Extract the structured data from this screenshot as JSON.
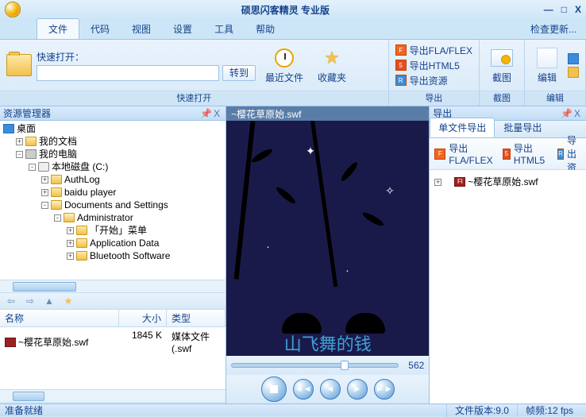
{
  "title": "硕思闪客精灵 专业版",
  "window": {
    "min": "—",
    "max": "□",
    "close": "X"
  },
  "menu": {
    "tabs": [
      "文件",
      "代码",
      "视图",
      "设置",
      "工具",
      "帮助"
    ],
    "active": 0,
    "update": "检查更新..."
  },
  "ribbon": {
    "quickopen": {
      "label": "快速打开：",
      "goto": "转到",
      "group": "快速打开",
      "value": ""
    },
    "recent": "最近文件",
    "fav": "收藏夹",
    "export_rows": [
      "导出FLA/FLEX",
      "导出HTML5",
      "导出资源"
    ],
    "export_group": "导出",
    "screenshot": "截图",
    "screenshot_group": "截图",
    "edit": "编辑",
    "edit_group": "编辑"
  },
  "left": {
    "title": "资源管理器",
    "pin": "📌",
    "close": "X",
    "tree": {
      "desktop": "桌面",
      "mydocs": "我的文档",
      "mypc": "我的电脑",
      "drive": "本地磁盘 (C:)",
      "folders": [
        "AuthLog",
        "baidu player",
        "Documents and Settings"
      ],
      "admin": "Administrator",
      "admin_children": [
        "「开始」菜单",
        "Application Data",
        "Bluetooth Software"
      ]
    },
    "nav": {
      "back": "⇦",
      "fwd": "⇨",
      "up": "▲",
      "star": "★"
    },
    "columns": {
      "name": "名称",
      "size": "大小",
      "type": "类型"
    },
    "file": {
      "name": "~樱花草原始.swf",
      "size": "1845 K",
      "type": "媒体文件(.swf"
    }
  },
  "center": {
    "title": "~樱花草原始.swf",
    "subtitle": "山飞舞的钱",
    "frame": "562"
  },
  "right": {
    "title": "导出",
    "tabs": [
      "单文件导出",
      "批量导出"
    ],
    "active": 0,
    "toolbar": {
      "fla": "导出\nFLA/FLEX",
      "html5": "导出HTML5",
      "res": "导出资"
    },
    "file": "~樱花草原始.swf"
  },
  "status": {
    "ready": "准备就绪",
    "version": "文件版本:9.0",
    "fps": "帧频:12 fps"
  }
}
